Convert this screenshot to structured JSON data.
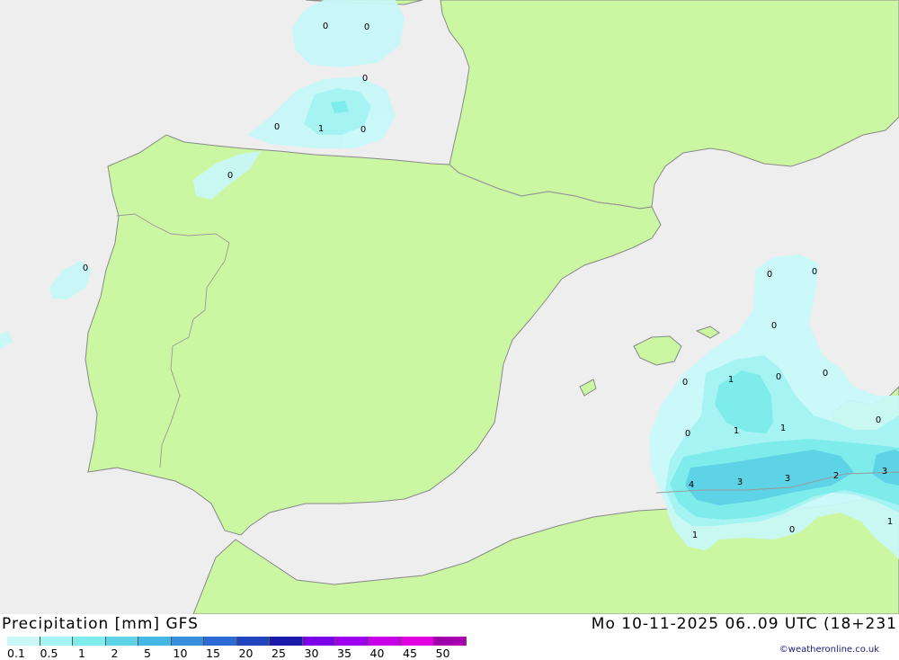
{
  "map": {
    "colors": {
      "sea": "#eeeeee",
      "land": "#cbf7a3",
      "border": "#9a9a9a",
      "coast": "#888888"
    },
    "labels": [
      {
        "t": "0"
      },
      {
        "t": "0"
      },
      {
        "t": "0"
      },
      {
        "t": "0"
      },
      {
        "t": "1"
      },
      {
        "t": "0"
      },
      {
        "t": "0"
      },
      {
        "t": "0"
      },
      {
        "t": "0"
      },
      {
        "t": "0"
      },
      {
        "t": "0"
      },
      {
        "t": "0"
      },
      {
        "t": "1"
      },
      {
        "t": "0"
      },
      {
        "t": "0"
      },
      {
        "t": "1"
      },
      {
        "t": "1"
      },
      {
        "t": "0"
      },
      {
        "t": "0"
      },
      {
        "t": "4"
      },
      {
        "t": "3"
      },
      {
        "t": "3"
      },
      {
        "t": "2"
      },
      {
        "t": "3"
      },
      {
        "t": "1"
      },
      {
        "t": "0"
      },
      {
        "t": "1"
      }
    ]
  },
  "footer": {
    "title": "Precipitation [mm] GFS",
    "datetime": "Mo 10-11-2025 06..09 UTC (18+231",
    "credit": "©weatheronline.co.uk"
  },
  "legend": {
    "levels": [
      "0.1",
      "0.5",
      "1",
      "2",
      "5",
      "10",
      "15",
      "20",
      "25",
      "30",
      "35",
      "40",
      "45",
      "50"
    ],
    "colors": [
      "#c8f8f8",
      "#a6f3f3",
      "#7fecec",
      "#5fd3e6",
      "#45b7e3",
      "#3a8fdd",
      "#2e6ad6",
      "#2244bd",
      "#1a1aa8",
      "#7b00e8",
      "#9f00f0",
      "#c800e8",
      "#e000e0",
      "#b000b0"
    ]
  }
}
